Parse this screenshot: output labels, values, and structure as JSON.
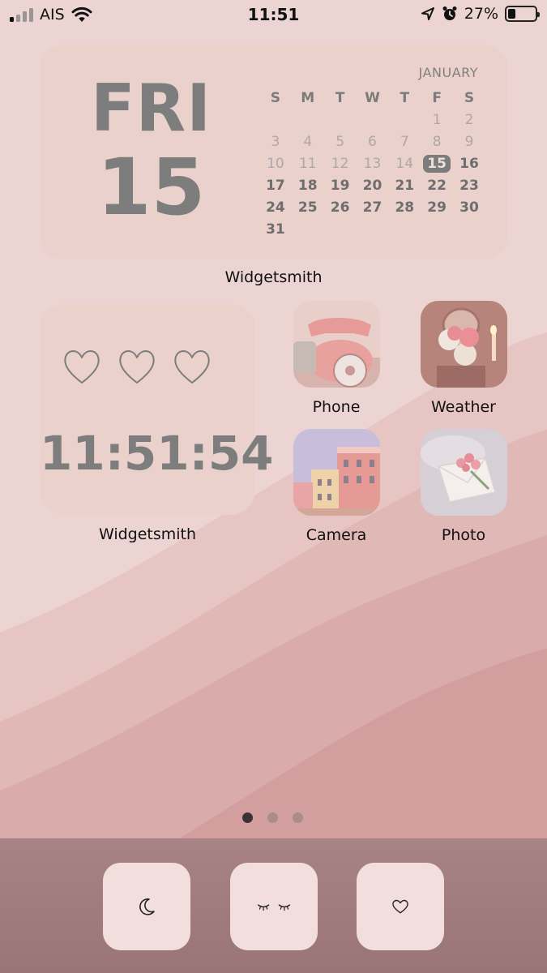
{
  "status_bar": {
    "carrier": "AIS",
    "time": "11:51",
    "battery_percent": "27%",
    "battery_level": 0.27
  },
  "date_widget": {
    "weekday": "FRI",
    "day": "15",
    "month": "JANUARY",
    "weekday_headers": [
      "S",
      "M",
      "T",
      "W",
      "T",
      "F",
      "S"
    ],
    "weeks": [
      [
        "",
        "",
        "",
        "",
        "",
        "1",
        "2"
      ],
      [
        "3",
        "4",
        "5",
        "6",
        "7",
        "8",
        "9"
      ],
      [
        "10",
        "11",
        "12",
        "13",
        "14",
        "15",
        "16"
      ],
      [
        "17",
        "18",
        "19",
        "20",
        "21",
        "22",
        "23"
      ],
      [
        "24",
        "25",
        "26",
        "27",
        "28",
        "29",
        "30"
      ],
      [
        "31",
        "",
        "",
        "",
        "",
        "",
        ""
      ]
    ],
    "today": "15",
    "label": "Widgetsmith"
  },
  "clock_widget": {
    "time": "11:51:54",
    "hearts": [
      "heart-icon",
      "heart-icon",
      "heart-icon"
    ],
    "label": "Widgetsmith"
  },
  "apps": [
    {
      "label": "Phone",
      "icon": "rotary-phone-photo"
    },
    {
      "label": "Weather",
      "icon": "roses-mirror-photo"
    },
    {
      "label": "Camera",
      "icon": "pink-buildings-photo"
    },
    {
      "label": "Photo",
      "icon": "flower-envelope-photo"
    }
  ],
  "page_dots": {
    "count": 3,
    "active": 1
  },
  "dock": {
    "items": [
      {
        "icon": "moon-icon"
      },
      {
        "icon": "closed-eyes-icon"
      },
      {
        "icon": "heart-icon"
      }
    ]
  }
}
